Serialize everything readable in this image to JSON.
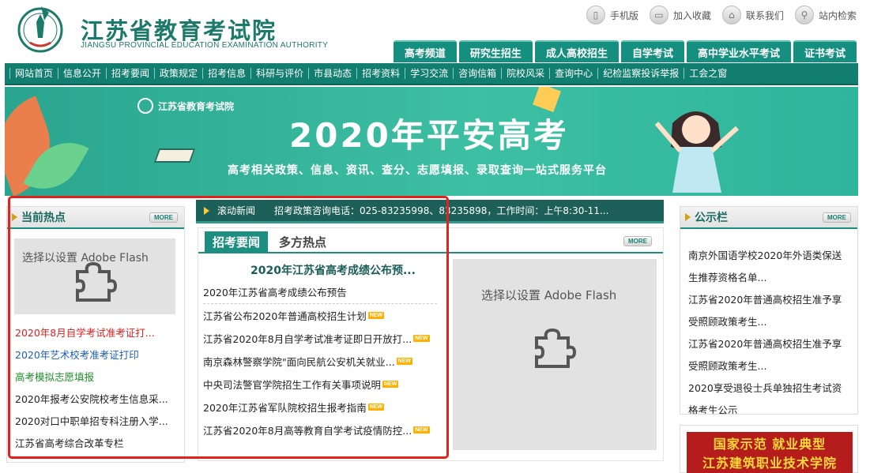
{
  "header": {
    "logo_cn": "江苏省教育考试院",
    "logo_en": "JIANGSU PROVINCIAL EDUCATION EXAMINATION AUTHORITY",
    "top_links": [
      {
        "label": "手机版",
        "icon": "phone-icon"
      },
      {
        "label": "加入收藏",
        "icon": "folder-icon"
      },
      {
        "label": "联系我们",
        "icon": "home-icon"
      },
      {
        "label": "站内检索",
        "icon": "search-icon"
      }
    ],
    "channel_tabs": [
      "高考频道",
      "研究生招生",
      "成人高校招生",
      "自学考试",
      "高中学业水平考试",
      "证书考试"
    ]
  },
  "nav": {
    "items": [
      "网站首页",
      "信息公开",
      "招考要闻",
      "政策规定",
      "招考信息",
      "科研与评价",
      "市县动态",
      "招考资料",
      "学习交流",
      "咨询信箱",
      "院校风采",
      "查询中心",
      "纪检监察投诉举报",
      "工会之窗"
    ]
  },
  "banner": {
    "logo_text": "江苏省教育考试院",
    "title": "2020年平安高考",
    "subtitle": "高考相关政策、信息、资讯、查分、志愿填报、录取查询一站式服务平台"
  },
  "left_panel": {
    "title": "当前热点",
    "more_label": "MORE",
    "flash_text": "选择以设置 Adobe Flash",
    "items": [
      {
        "text": "2020年8月自学考试准考证打...",
        "color": "#e02020"
      },
      {
        "text": "2020年艺术校考准考证打印",
        "color": "#1c5fb8"
      },
      {
        "text": "高考模拟志愿填报",
        "color": "#1f8f2a"
      },
      {
        "text": "2020年报考公安院校考生信息采...",
        "color": "#222222"
      },
      {
        "text": "2020对口中职单招专科注册入学...",
        "color": "#222222"
      },
      {
        "text": "江苏省高考综合改革专栏",
        "color": "#222222"
      }
    ]
  },
  "scroll_news": {
    "label": "滚动新闻",
    "text": "招考政策咨询电话：025-83235998、83235898，工作时间：上午8:30-11..."
  },
  "middle_panel": {
    "tabs": [
      "招考要闻",
      "多方热点"
    ],
    "more_label": "MORE",
    "headline": "2020年江苏省高考成绩公布预...",
    "flash_text": "选择以设置 Adobe Flash",
    "news": [
      {
        "text": "2020年江苏省高考成绩公布预告",
        "is_new": false
      },
      {
        "text": "江苏省公布2020年普通高校招生计划",
        "is_new": true
      },
      {
        "text": "江苏省2020年8月自学考试准考证即日开放打...",
        "is_new": true
      },
      {
        "text": "南京森林警察学院\"面向民航公安机关就业...",
        "is_new": true
      },
      {
        "text": "中央司法警官学院招生工作有关事项说明",
        "is_new": true
      },
      {
        "text": "2020年江苏省军队院校招生报考指南",
        "is_new": true
      },
      {
        "text": "江苏省2020年8月高等教育自学考试疫情防控...",
        "is_new": true
      }
    ],
    "new_badge": "NEW"
  },
  "right_panel": {
    "title": "公示栏",
    "more_label": "MORE",
    "items": [
      "南京外国语学校2020年外语类保送生推荐资格名单...",
      "江苏省2020年普通高校招生准予享受照顾政策考生...",
      "江苏省2020年普通高校招生准予享受照顾政策考生...",
      "2020享受退役士兵单独招生考试资格考生公示"
    ]
  },
  "ad": {
    "line1": "国家示范  就业典型",
    "line2": "江苏建筑职业技术学院"
  },
  "colors": {
    "brand_teal": "#127e6f",
    "highlight_red": "#e3221c",
    "new_badge": "#ffb000"
  }
}
